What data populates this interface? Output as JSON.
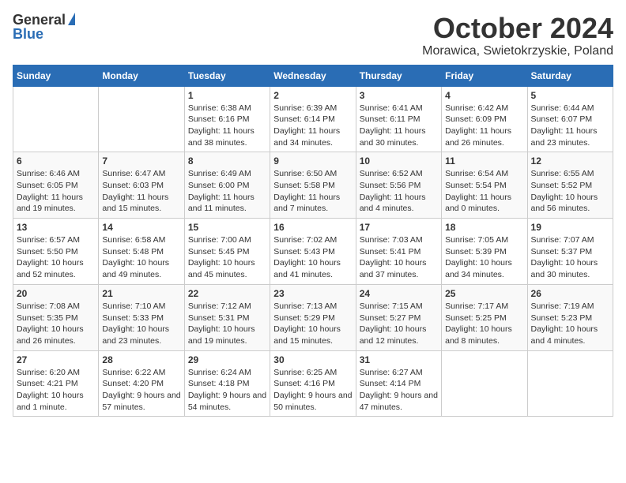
{
  "header": {
    "logo_general": "General",
    "logo_blue": "Blue",
    "title": "October 2024",
    "subtitle": "Morawica, Swietokrzyskie, Poland"
  },
  "weekdays": [
    "Sunday",
    "Monday",
    "Tuesday",
    "Wednesday",
    "Thursday",
    "Friday",
    "Saturday"
  ],
  "weeks": [
    [
      {
        "day": "",
        "content": ""
      },
      {
        "day": "",
        "content": ""
      },
      {
        "day": "1",
        "content": "Sunrise: 6:38 AM\nSunset: 6:16 PM\nDaylight: 11 hours and 38 minutes."
      },
      {
        "day": "2",
        "content": "Sunrise: 6:39 AM\nSunset: 6:14 PM\nDaylight: 11 hours and 34 minutes."
      },
      {
        "day": "3",
        "content": "Sunrise: 6:41 AM\nSunset: 6:11 PM\nDaylight: 11 hours and 30 minutes."
      },
      {
        "day": "4",
        "content": "Sunrise: 6:42 AM\nSunset: 6:09 PM\nDaylight: 11 hours and 26 minutes."
      },
      {
        "day": "5",
        "content": "Sunrise: 6:44 AM\nSunset: 6:07 PM\nDaylight: 11 hours and 23 minutes."
      }
    ],
    [
      {
        "day": "6",
        "content": "Sunrise: 6:46 AM\nSunset: 6:05 PM\nDaylight: 11 hours and 19 minutes."
      },
      {
        "day": "7",
        "content": "Sunrise: 6:47 AM\nSunset: 6:03 PM\nDaylight: 11 hours and 15 minutes."
      },
      {
        "day": "8",
        "content": "Sunrise: 6:49 AM\nSunset: 6:00 PM\nDaylight: 11 hours and 11 minutes."
      },
      {
        "day": "9",
        "content": "Sunrise: 6:50 AM\nSunset: 5:58 PM\nDaylight: 11 hours and 7 minutes."
      },
      {
        "day": "10",
        "content": "Sunrise: 6:52 AM\nSunset: 5:56 PM\nDaylight: 11 hours and 4 minutes."
      },
      {
        "day": "11",
        "content": "Sunrise: 6:54 AM\nSunset: 5:54 PM\nDaylight: 11 hours and 0 minutes."
      },
      {
        "day": "12",
        "content": "Sunrise: 6:55 AM\nSunset: 5:52 PM\nDaylight: 10 hours and 56 minutes."
      }
    ],
    [
      {
        "day": "13",
        "content": "Sunrise: 6:57 AM\nSunset: 5:50 PM\nDaylight: 10 hours and 52 minutes."
      },
      {
        "day": "14",
        "content": "Sunrise: 6:58 AM\nSunset: 5:48 PM\nDaylight: 10 hours and 49 minutes."
      },
      {
        "day": "15",
        "content": "Sunrise: 7:00 AM\nSunset: 5:45 PM\nDaylight: 10 hours and 45 minutes."
      },
      {
        "day": "16",
        "content": "Sunrise: 7:02 AM\nSunset: 5:43 PM\nDaylight: 10 hours and 41 minutes."
      },
      {
        "day": "17",
        "content": "Sunrise: 7:03 AM\nSunset: 5:41 PM\nDaylight: 10 hours and 37 minutes."
      },
      {
        "day": "18",
        "content": "Sunrise: 7:05 AM\nSunset: 5:39 PM\nDaylight: 10 hours and 34 minutes."
      },
      {
        "day": "19",
        "content": "Sunrise: 7:07 AM\nSunset: 5:37 PM\nDaylight: 10 hours and 30 minutes."
      }
    ],
    [
      {
        "day": "20",
        "content": "Sunrise: 7:08 AM\nSunset: 5:35 PM\nDaylight: 10 hours and 26 minutes."
      },
      {
        "day": "21",
        "content": "Sunrise: 7:10 AM\nSunset: 5:33 PM\nDaylight: 10 hours and 23 minutes."
      },
      {
        "day": "22",
        "content": "Sunrise: 7:12 AM\nSunset: 5:31 PM\nDaylight: 10 hours and 19 minutes."
      },
      {
        "day": "23",
        "content": "Sunrise: 7:13 AM\nSunset: 5:29 PM\nDaylight: 10 hours and 15 minutes."
      },
      {
        "day": "24",
        "content": "Sunrise: 7:15 AM\nSunset: 5:27 PM\nDaylight: 10 hours and 12 minutes."
      },
      {
        "day": "25",
        "content": "Sunrise: 7:17 AM\nSunset: 5:25 PM\nDaylight: 10 hours and 8 minutes."
      },
      {
        "day": "26",
        "content": "Sunrise: 7:19 AM\nSunset: 5:23 PM\nDaylight: 10 hours and 4 minutes."
      }
    ],
    [
      {
        "day": "27",
        "content": "Sunrise: 6:20 AM\nSunset: 4:21 PM\nDaylight: 10 hours and 1 minute."
      },
      {
        "day": "28",
        "content": "Sunrise: 6:22 AM\nSunset: 4:20 PM\nDaylight: 9 hours and 57 minutes."
      },
      {
        "day": "29",
        "content": "Sunrise: 6:24 AM\nSunset: 4:18 PM\nDaylight: 9 hours and 54 minutes."
      },
      {
        "day": "30",
        "content": "Sunrise: 6:25 AM\nSunset: 4:16 PM\nDaylight: 9 hours and 50 minutes."
      },
      {
        "day": "31",
        "content": "Sunrise: 6:27 AM\nSunset: 4:14 PM\nDaylight: 9 hours and 47 minutes."
      },
      {
        "day": "",
        "content": ""
      },
      {
        "day": "",
        "content": ""
      }
    ]
  ]
}
